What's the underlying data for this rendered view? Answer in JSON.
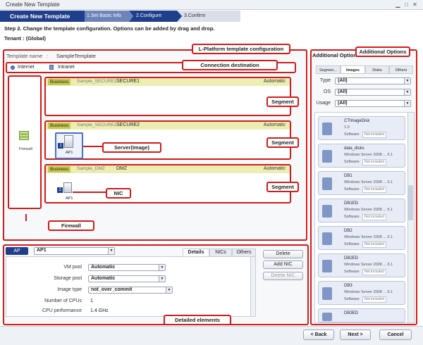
{
  "window": {
    "title": "Create New Template"
  },
  "wizard": {
    "steps": [
      "Create New Template",
      "1.Set Basic Info",
      "2.Configure",
      "3.Confirm"
    ]
  },
  "instructions": "Step 2. Change the template configuration.  Options can be added by drag and drop.",
  "tenant": "Tenant : (Global)",
  "template": {
    "name_label": "Template name",
    "name_value": "SampleTemplate"
  },
  "connections": [
    {
      "label": "Internet",
      "icon": "globe-icon"
    },
    {
      "label": "Intranet",
      "icon": "building-icon"
    }
  ],
  "firewall": {
    "label": "Firewall"
  },
  "segments": [
    {
      "badge": "Business",
      "sub": "Sample_SECURE1",
      "name": "SECURE1",
      "mode": "Automatic"
    },
    {
      "badge": "Business",
      "sub": "Sample_SECURE2",
      "name": "SECURE2",
      "mode": "Automatic",
      "server": {
        "index": "1",
        "label": "AP1"
      }
    },
    {
      "badge": "Business",
      "sub": "Sample_DMZ",
      "name": "DMZ",
      "mode": "Automatic",
      "server": {
        "index": "2",
        "label": "AP1"
      }
    }
  ],
  "callouts": {
    "lplatform": "L-Platform template configuration",
    "connection": "Connection destination",
    "segment1": "Segment",
    "segment2": "Segment",
    "segment3": "Segment",
    "server": "Server(Image)",
    "nic": "NIC",
    "firewall": "Firewall",
    "detailed": "Detailed elements",
    "addopts": "Additional Options"
  },
  "detail": {
    "type_badge": "AP",
    "selected": "AP1",
    "tabs": [
      "Details",
      "NICs",
      "Others"
    ],
    "active_tab": "Details",
    "buttons": {
      "delete": "Delete",
      "add_nic": "Add NIC",
      "delete_nic": "Delete NIC"
    },
    "rows": [
      {
        "label": "VM pool",
        "value": "Automatic",
        "kind": "select"
      },
      {
        "label": "Storage pool",
        "value": "Automatic",
        "kind": "select"
      },
      {
        "label": "Image type",
        "value": "not_over_commit",
        "kind": "select"
      },
      {
        "label": "Number of CPUs",
        "value": "1",
        "kind": "text"
      },
      {
        "label": "CPU performance",
        "value": "1.4 GHz",
        "kind": "text"
      }
    ]
  },
  "additional": {
    "title": "Additional Options",
    "tabs": [
      "Segmen...",
      "Images",
      "Disks",
      "Others"
    ],
    "active_tab": "Images",
    "filters": [
      {
        "label": "Type",
        "value": "(All)"
      },
      {
        "label": "OS",
        "value": "(All)"
      },
      {
        "label": "Usage",
        "value": "(All)"
      }
    ],
    "items": [
      {
        "name": "CTImageDisk",
        "ver": "1.0",
        "sw": "Software",
        "ni": "Not included"
      },
      {
        "name": "data_disks",
        "ver": "Windows Server 2008 ...    6.1",
        "sw": "Software",
        "ni": "Not included"
      },
      {
        "name": "DB1",
        "ver": "Windows Server 2008 ...    6.1",
        "sw": "Software",
        "ni": "Not included"
      },
      {
        "name": "DB1ED",
        "ver": "Windows Server 2008 ...    6.1",
        "sw": "Software",
        "ni": "Not included"
      },
      {
        "name": "DB2",
        "ver": "Windows Server 2008 ...    6.1",
        "sw": "Software",
        "ni": "Not included"
      },
      {
        "name": "DB2ED",
        "ver": "Windows Server 2008 ...    6.1",
        "sw": "Software",
        "ni": "Not included"
      },
      {
        "name": "DB3",
        "ver": "Windows Server 2008 ...    6.1",
        "sw": "Software",
        "ni": "Not included"
      },
      {
        "name": "DB3ED",
        "ver": "",
        "sw": "",
        "ni": ""
      }
    ]
  },
  "footer": {
    "back": "< Back",
    "next": "Next >",
    "cancel": "Cancel"
  },
  "colors": {
    "accent": "#1f3f8c",
    "callout": "#d51a1a",
    "segment_header": "#ebeeb0",
    "badge": "#c4c850"
  }
}
